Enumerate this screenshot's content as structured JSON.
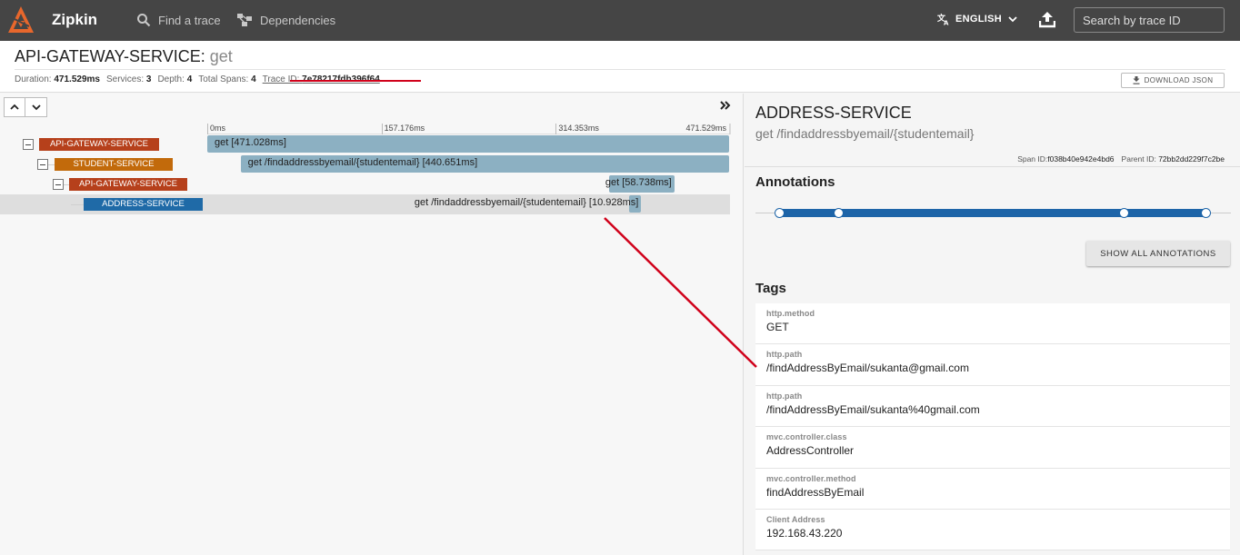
{
  "app": {
    "name": "Zipkin",
    "nav": {
      "find_trace": "Find a trace",
      "dependencies": "Dependencies"
    },
    "language": "ENGLISH",
    "search_placeholder": "Search by trace ID"
  },
  "trace": {
    "service": "API-GATEWAY-SERVICE:",
    "method": "get",
    "stats": {
      "duration_label": "Duration:",
      "duration": "471.529ms",
      "services_label": "Services:",
      "services": "3",
      "depth_label": "Depth:",
      "depth": "4",
      "spans_label": "Total Spans:",
      "spans": "4",
      "traceid_label": "Trace ID:",
      "traceid": "7e78217fdb396f64"
    },
    "download_label": "DOWNLOAD JSON"
  },
  "timeline": {
    "total_ms": 471.529,
    "ticks": [
      {
        "label": "0ms",
        "ms": 0
      },
      {
        "label": "157.176ms",
        "ms": 157.176
      },
      {
        "label": "314.353ms",
        "ms": 314.353
      },
      {
        "label": "471.529ms",
        "ms": 471.529
      }
    ],
    "spans": [
      {
        "service": "API-GATEWAY-SERVICE",
        "kind": "gw",
        "depth": 0,
        "label": "get [471.028ms]",
        "start_ms": 0,
        "duration_ms": 471.028
      },
      {
        "service": "STUDENT-SERVICE",
        "kind": "st",
        "depth": 1,
        "label": "get /findaddressbyemail/{studentemail} [440.651ms]",
        "start_ms": 30.0,
        "duration_ms": 440.651
      },
      {
        "service": "API-GATEWAY-SERVICE",
        "kind": "gw",
        "depth": 2,
        "label": "get [58.738ms]",
        "start_ms": 362.5,
        "duration_ms": 58.738
      },
      {
        "service": "ADDRESS-SERVICE",
        "kind": "ad",
        "depth": 3,
        "label": "get /findaddressbyemail/{studentemail} [10.928ms]",
        "start_ms": 380.5,
        "duration_ms": 10.928
      }
    ]
  },
  "detail": {
    "service": "ADDRESS-SERVICE",
    "span_name": "get /findaddressbyemail/{studentemail}",
    "span_id_label": "Span ID:",
    "span_id": "f038b40e942e4bd6",
    "parent_id_label": "Parent ID:",
    "parent_id": "72bb2dd229f7c2be",
    "annotations_title": "Annotations",
    "show_all": "SHOW ALL ANNOTATIONS",
    "tags_title": "Tags",
    "tags": [
      {
        "key": "http.method",
        "value": "GET"
      },
      {
        "key": "http.path",
        "value": "/findAddressByEmail/sukanta@gmail.com"
      },
      {
        "key": "http.path",
        "value": "/findAddressByEmail/sukanta%40gmail.com"
      },
      {
        "key": "mvc.controller.class",
        "value": "AddressController"
      },
      {
        "key": "mvc.controller.method",
        "value": "findAddressByEmail"
      },
      {
        "key": "Client Address",
        "value": "192.168.43.220"
      }
    ]
  },
  "colors": {
    "topbar": "#454545",
    "gateway": "#b6401b",
    "student": "#c26a0b",
    "address": "#1f6aa7",
    "span_bar": "#8cb0c2",
    "annotation": "#1d64a8",
    "highlight": "#d0021b"
  }
}
